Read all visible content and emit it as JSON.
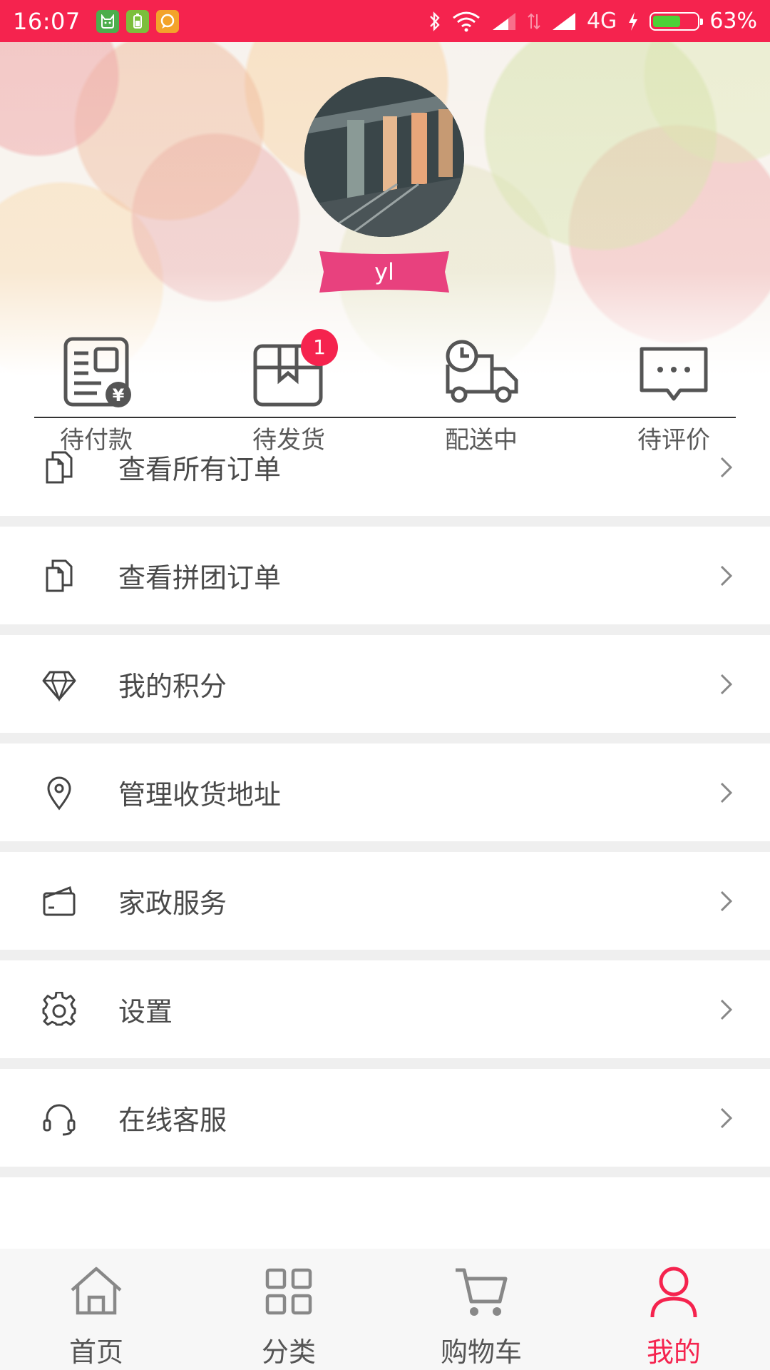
{
  "status_bar": {
    "time": "16:07",
    "network": "4G",
    "battery_percent": "63%",
    "battery_level": 0.63,
    "colors": {
      "background": "#f5234e"
    },
    "icons": [
      "cat-app-icon",
      "battery-app-icon",
      "chat-app-icon",
      "bluetooth-icon",
      "wifi-icon",
      "signal-icon",
      "data-icon",
      "signal-icon",
      "charging-icon",
      "battery-icon"
    ]
  },
  "profile": {
    "username": "yl",
    "ribbon_color": "#e8417e"
  },
  "order_status": [
    {
      "label": "待付款",
      "icon": "pending-payment-icon",
      "badge": null
    },
    {
      "label": "待发货",
      "icon": "pending-shipment-icon",
      "badge": "1"
    },
    {
      "label": "配送中",
      "icon": "delivery-truck-icon",
      "badge": null
    },
    {
      "label": "待评价",
      "icon": "review-chat-icon",
      "badge": null
    }
  ],
  "menu": [
    {
      "label": "查看所有订单",
      "icon": "document-icon"
    },
    {
      "label": "查看拼团订单",
      "icon": "document-icon"
    },
    {
      "label": "我的积分",
      "icon": "diamond-icon"
    },
    {
      "label": "管理收货地址",
      "icon": "location-pin-icon"
    },
    {
      "label": "家政服务",
      "icon": "wallet-icon"
    },
    {
      "label": "设置",
      "icon": "gear-icon"
    },
    {
      "label": "在线客服",
      "icon": "headset-icon"
    }
  ],
  "bottom_nav": {
    "active_color": "#f5234e",
    "items": [
      {
        "label": "首页",
        "icon": "home-icon"
      },
      {
        "label": "分类",
        "icon": "category-grid-icon"
      },
      {
        "label": "购物车",
        "icon": "cart-icon"
      },
      {
        "label": "我的",
        "icon": "user-icon",
        "active": true
      }
    ]
  }
}
